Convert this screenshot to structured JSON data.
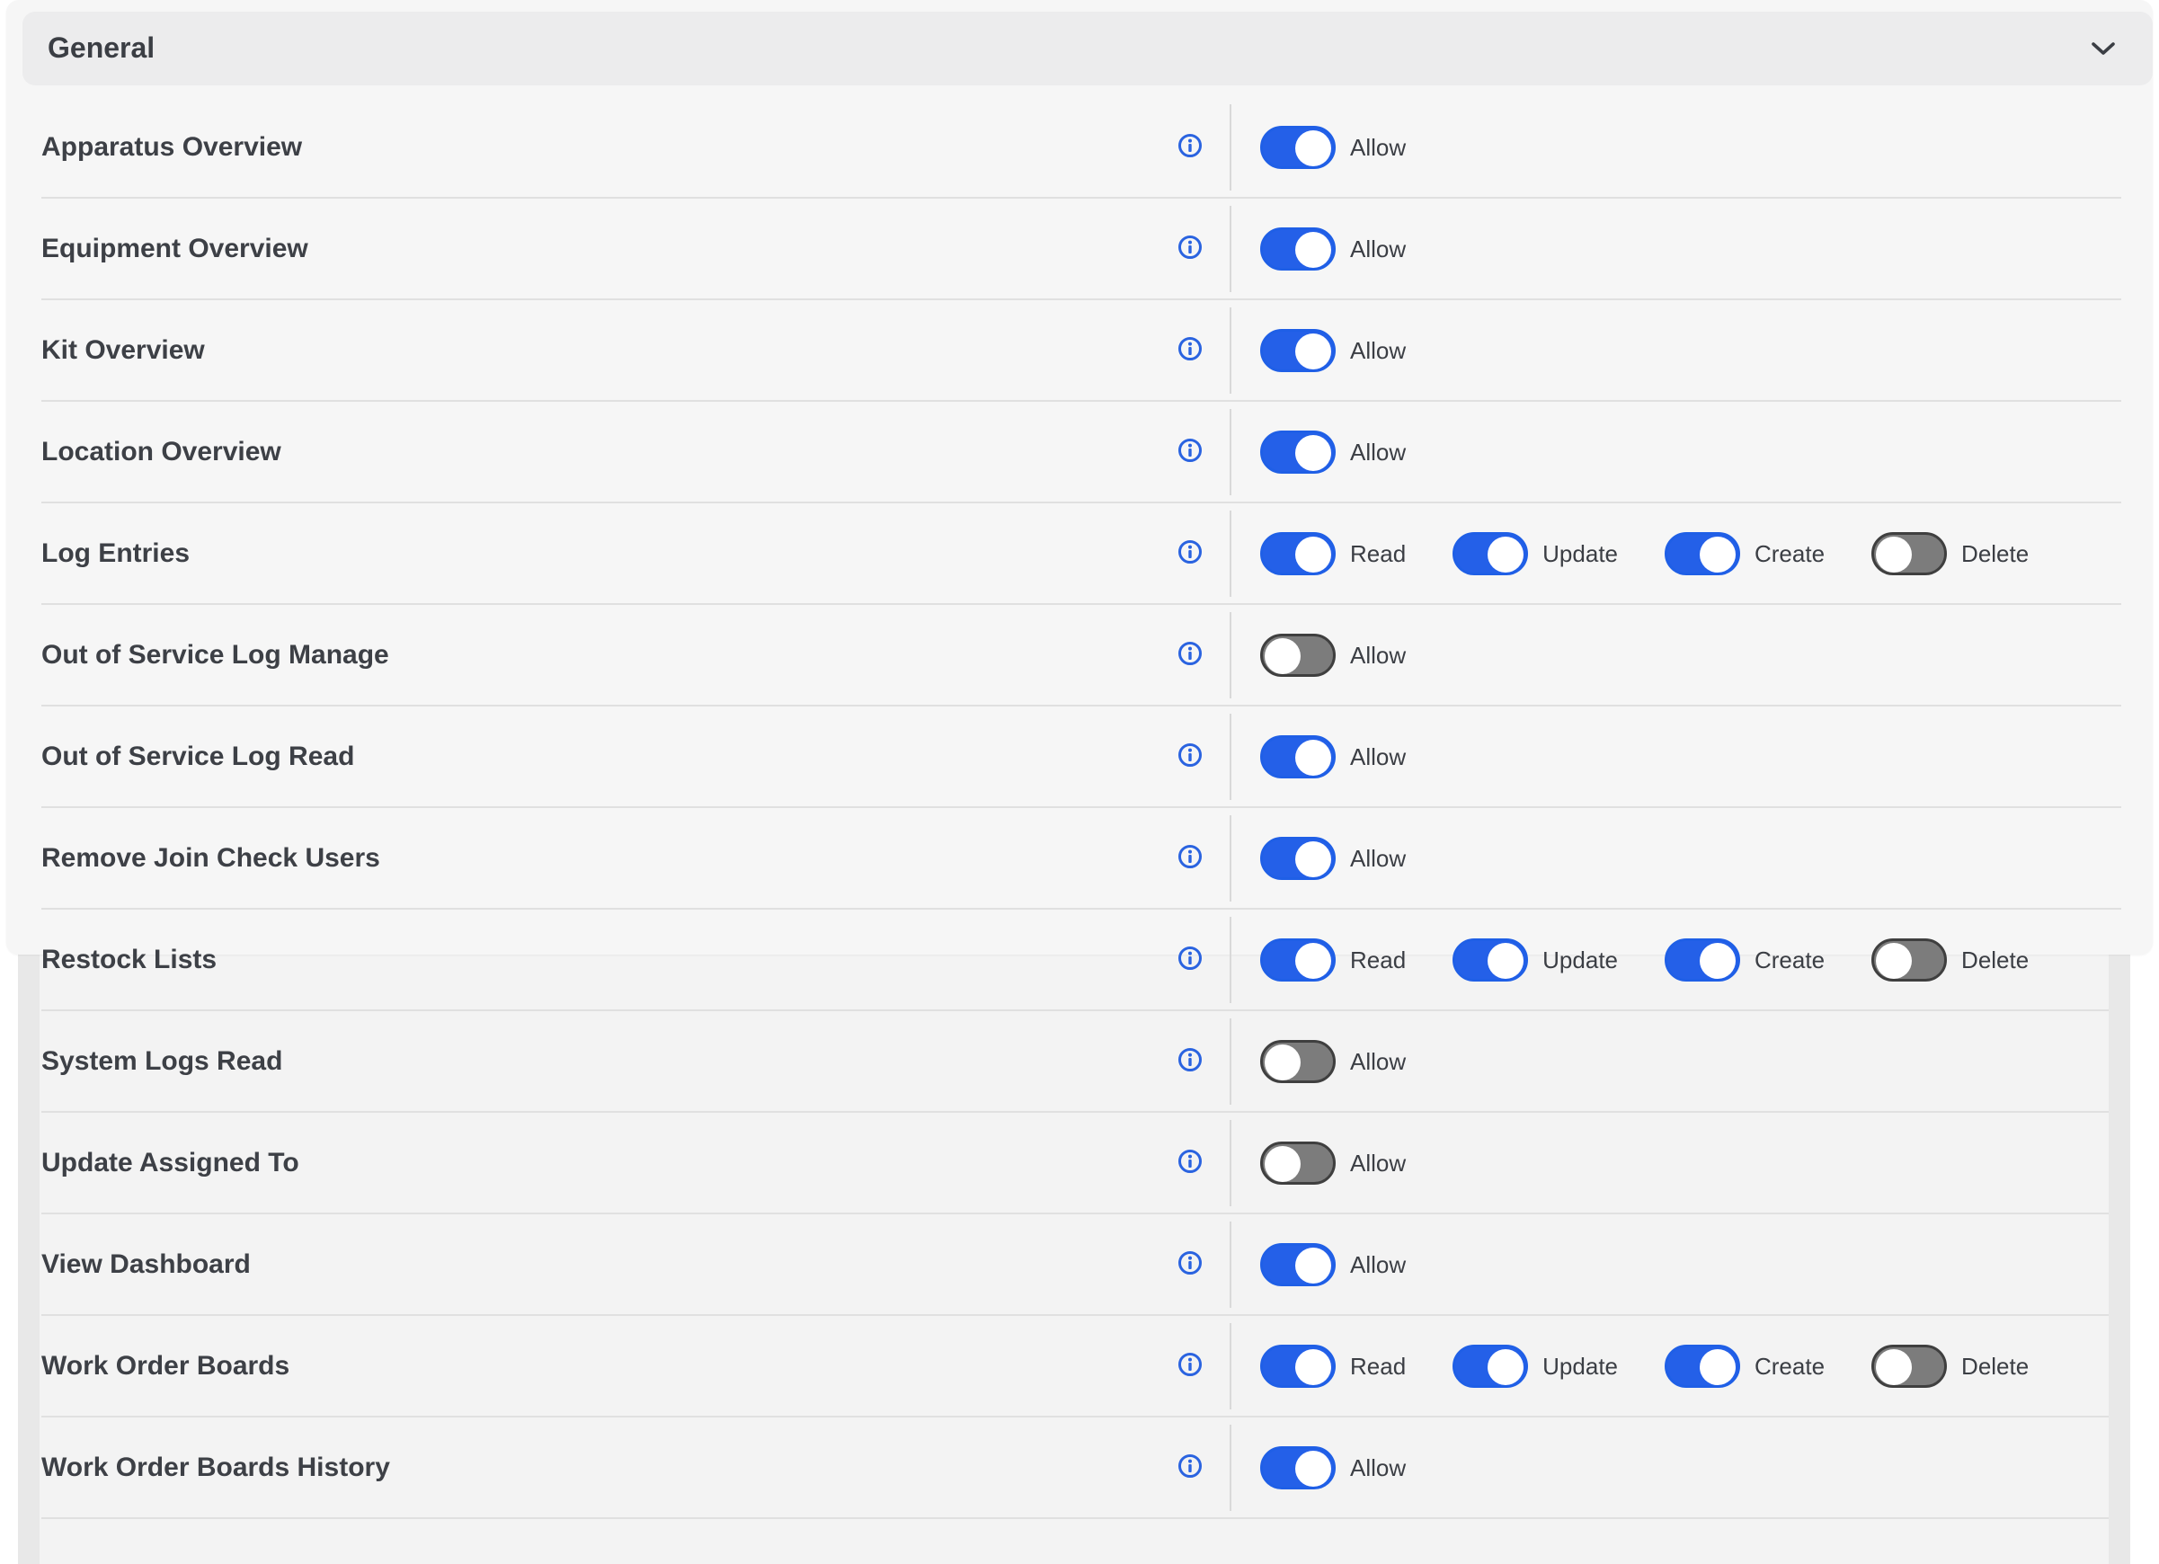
{
  "section": {
    "title": "General"
  },
  "rows": [
    {
      "label": "Apparatus Overview",
      "perms": [
        {
          "label": "Allow",
          "on": true
        }
      ]
    },
    {
      "label": "Equipment Overview",
      "perms": [
        {
          "label": "Allow",
          "on": true
        }
      ]
    },
    {
      "label": "Kit Overview",
      "perms": [
        {
          "label": "Allow",
          "on": true
        }
      ]
    },
    {
      "label": "Location Overview",
      "perms": [
        {
          "label": "Allow",
          "on": true
        }
      ]
    },
    {
      "label": "Log Entries",
      "perms": [
        {
          "label": "Read",
          "on": true
        },
        {
          "label": "Update",
          "on": true
        },
        {
          "label": "Create",
          "on": true
        },
        {
          "label": "Delete",
          "on": false
        }
      ]
    },
    {
      "label": "Out of Service Log Manage",
      "perms": [
        {
          "label": "Allow",
          "on": false
        }
      ]
    },
    {
      "label": "Out of Service Log Read",
      "perms": [
        {
          "label": "Allow",
          "on": true
        }
      ]
    },
    {
      "label": "Remove Join Check Users",
      "perms": [
        {
          "label": "Allow",
          "on": true
        }
      ]
    },
    {
      "label": "Restock Lists",
      "perms": [
        {
          "label": "Read",
          "on": true
        },
        {
          "label": "Update",
          "on": true
        },
        {
          "label": "Create",
          "on": true
        },
        {
          "label": "Delete",
          "on": false
        }
      ]
    },
    {
      "label": "System Logs Read",
      "perms": [
        {
          "label": "Allow",
          "on": false
        }
      ]
    },
    {
      "label": "Update Assigned To",
      "perms": [
        {
          "label": "Allow",
          "on": false
        }
      ]
    },
    {
      "label": "View Dashboard",
      "perms": [
        {
          "label": "Allow",
          "on": true
        }
      ]
    },
    {
      "label": "Work Order Boards",
      "perms": [
        {
          "label": "Read",
          "on": true
        },
        {
          "label": "Update",
          "on": true
        },
        {
          "label": "Create",
          "on": true
        },
        {
          "label": "Delete",
          "on": false
        }
      ]
    },
    {
      "label": "Work Order Boards History",
      "perms": [
        {
          "label": "Allow",
          "on": true
        }
      ]
    }
  ],
  "colors": {
    "accent": "#2460e8",
    "toggle_off": "#7c7c7c",
    "info_icon": "#2a63e0"
  }
}
